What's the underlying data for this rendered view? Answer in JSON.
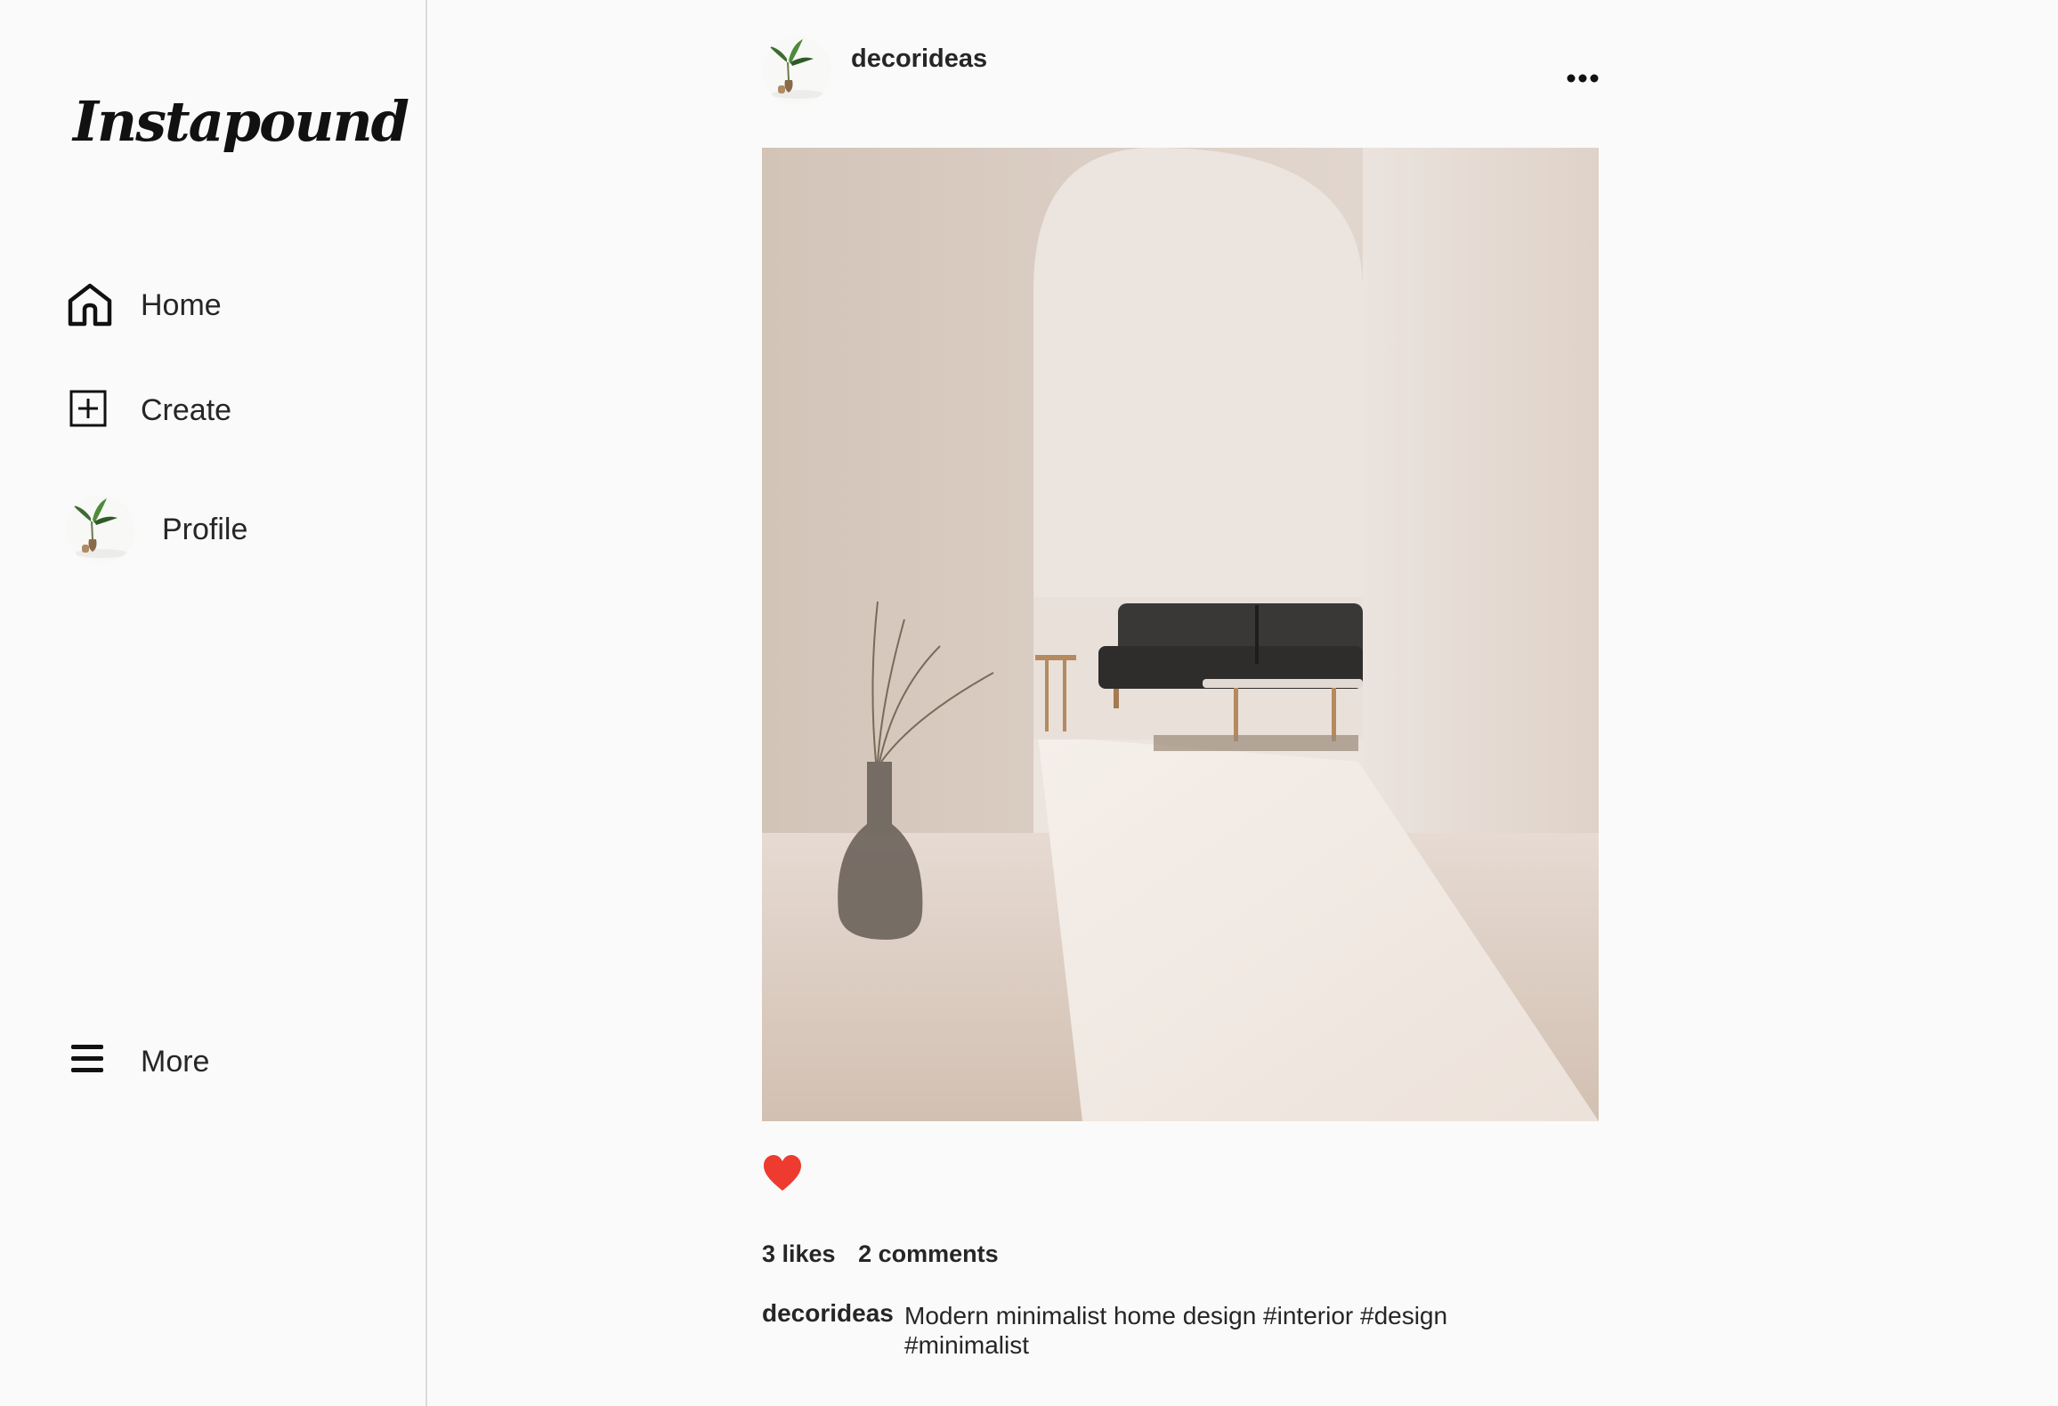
{
  "app": {
    "logo": "Instapound"
  },
  "sidebar": {
    "items": [
      {
        "label": "Home",
        "icon": "home-icon"
      },
      {
        "label": "Create",
        "icon": "plus-square-icon"
      },
      {
        "label": "Profile",
        "icon": "avatar"
      },
      {
        "label": "More",
        "icon": "hamburger-menu-icon"
      }
    ]
  },
  "post": {
    "username": "decorideas",
    "likes": "3 likes",
    "comments": "2 comments",
    "caption_user": "decorideas",
    "caption": "Modern minimalist home design #interior #design #minimalist",
    "liked": true,
    "heart_color": "#ed3b2f"
  }
}
